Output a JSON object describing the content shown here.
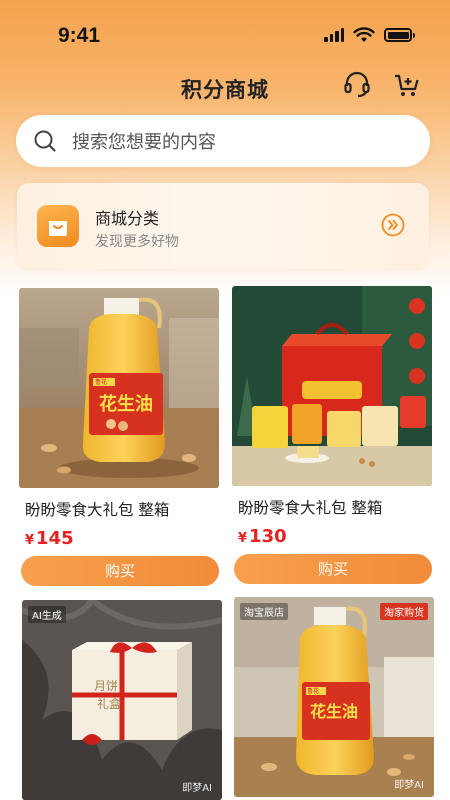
{
  "status_bar": {
    "time": "9:41"
  },
  "nav": {
    "title": "积分商城",
    "service_icon": "headset-icon",
    "cart_icon": "cart-add-icon"
  },
  "search": {
    "placeholder": "搜索您想要的内容",
    "icon": "search-icon"
  },
  "category": {
    "title": "商城分类",
    "subtitle": "发现更多好物",
    "icon": "shopping-bag-icon",
    "arrow": "double-chevron-right-icon"
  },
  "products": [
    {
      "name": "盼盼零食大礼包 整箱",
      "currency": "¥",
      "price": "145",
      "buy_label": "购买",
      "image": "peanut-oil-bottle",
      "oil_label": "花生油",
      "oil_brand": "鲁花"
    },
    {
      "name": "盼盼零食大礼包 整箱",
      "currency": "¥",
      "price": "130",
      "buy_label": "购买",
      "image": "snack-gift-box"
    },
    {
      "image": "mooncake-gift-box",
      "tag": "AI生成",
      "watermark": "即梦AI",
      "box_label_1": "月饼",
      "box_label_2": "礼盒"
    },
    {
      "image": "peanut-oil-bottle",
      "tag": "淘宝辰店",
      "tag2": "淘家购货",
      "watermark": "即梦AI",
      "oil_label": "花生油",
      "oil_brand": "鲁花"
    }
  ],
  "colors": {
    "accent": "#f28b39",
    "price": "#e62222",
    "header_top": "#f6a24c"
  }
}
